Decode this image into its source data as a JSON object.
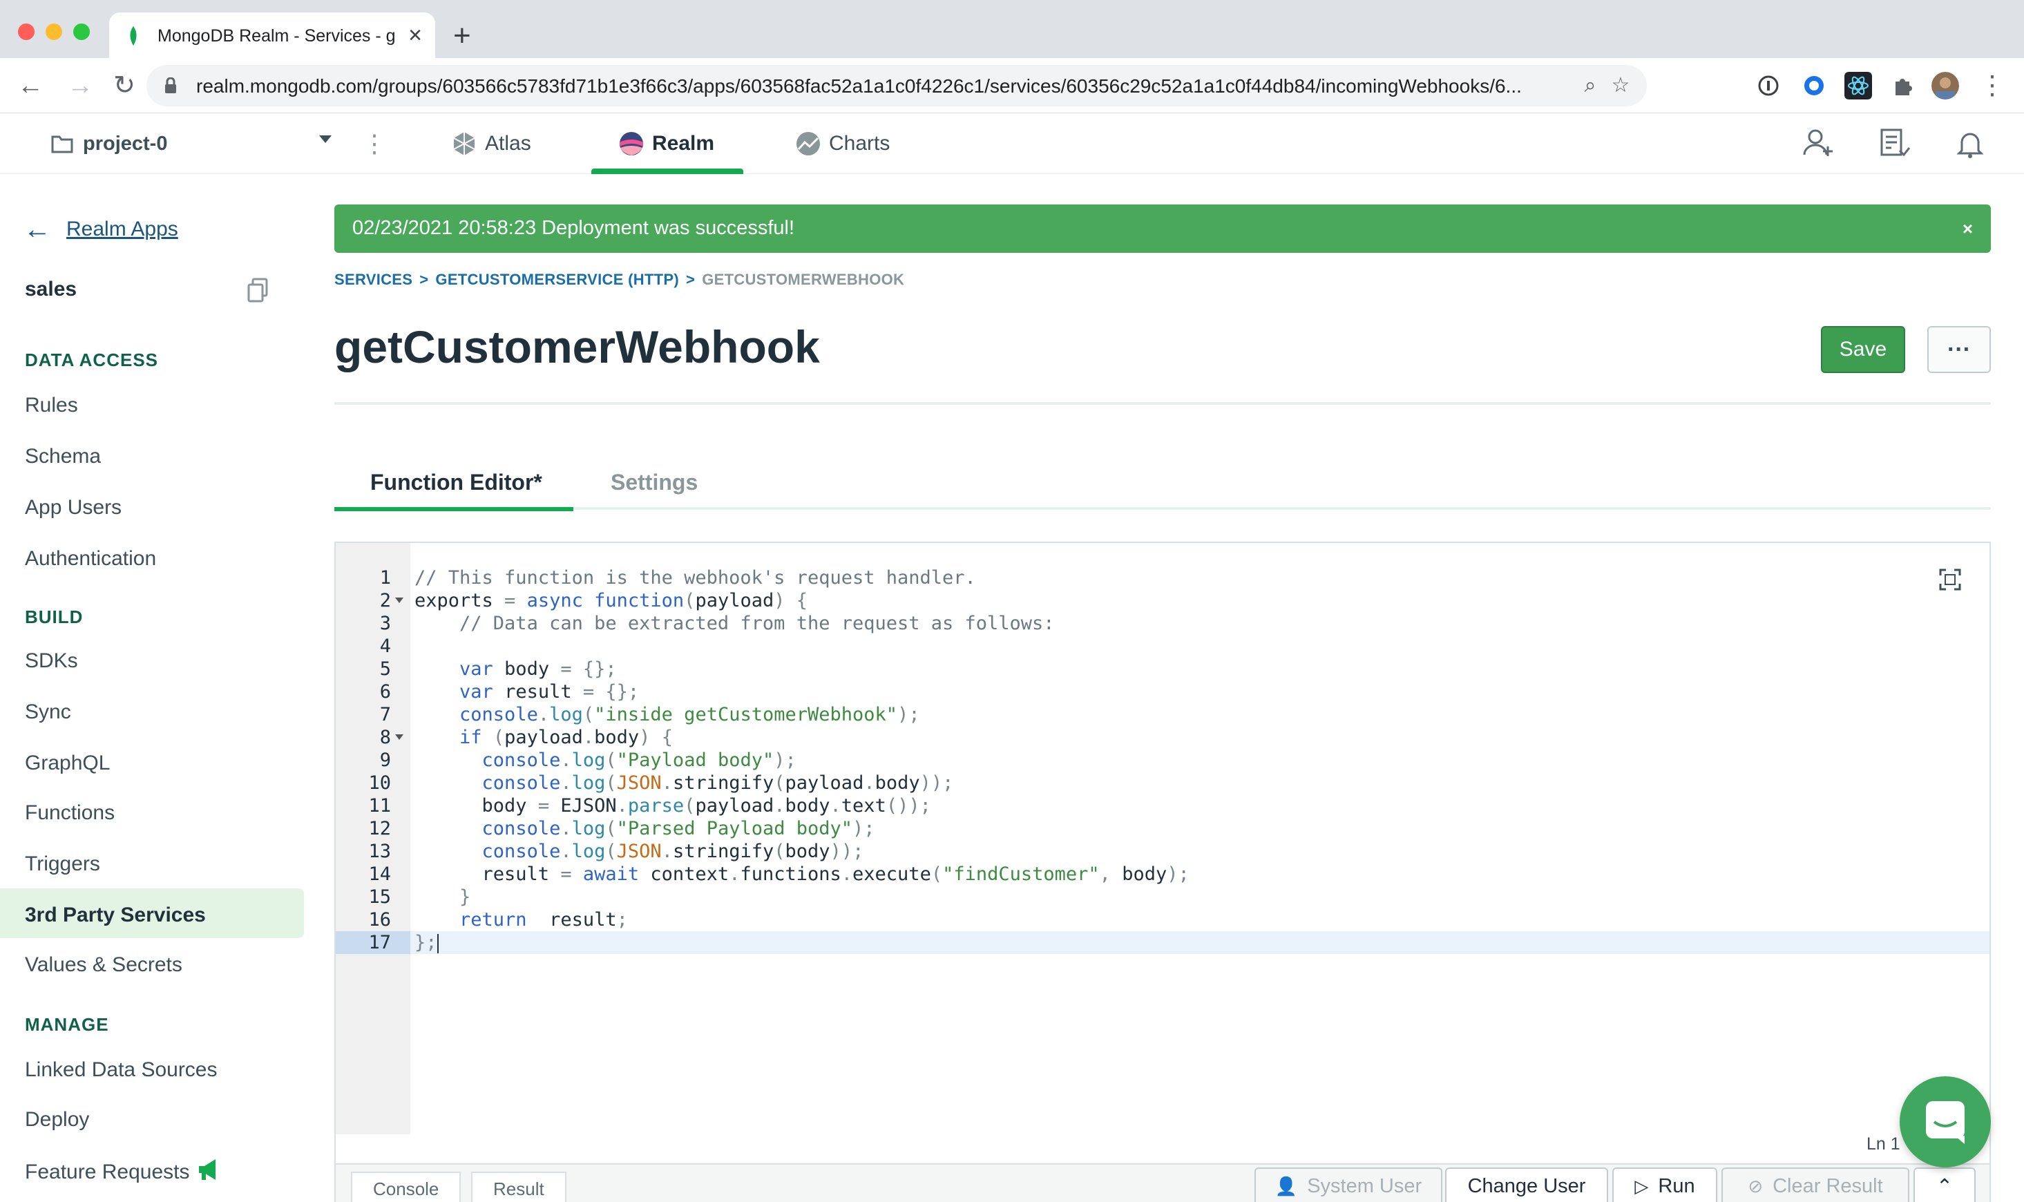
{
  "browser": {
    "tab_title": "MongoDB Realm - Services - g",
    "url": "realm.mongodb.com/groups/603566c5783fd71b1e3f66c3/apps/603568fac52a1a1c0f4226c1/services/60356c29c52a1a1c0f44db84/incomingWebhooks/6..."
  },
  "topnav": {
    "project": "project-0",
    "tabs": [
      "Atlas",
      "Realm",
      "Charts"
    ],
    "active_tab": "Realm",
    "accent_color": "#13aa52"
  },
  "sidebar": {
    "back_label": "Realm Apps",
    "app_name": "sales",
    "sections": [
      {
        "title": "DATA ACCESS",
        "items": [
          "Rules",
          "Schema",
          "App Users",
          "Authentication"
        ]
      },
      {
        "title": "BUILD",
        "items": [
          "SDKs",
          "Sync",
          "GraphQL",
          "Functions",
          "Triggers",
          "3rd Party Services",
          "Values & Secrets"
        ]
      },
      {
        "title": "MANAGE",
        "items": [
          "Linked Data Sources",
          "Deploy",
          "Feature Requests"
        ]
      }
    ],
    "active_item": "3rd Party Services"
  },
  "banner": {
    "text": "02/23/2021 20:58:23 Deployment was successful!",
    "close": "×",
    "color": "#4aa85a"
  },
  "breadcrumb": {
    "items": [
      "SERVICES",
      "GETCUSTOMERSERVICE (HTTP)",
      "GETCUSTOMERWEBHOOK"
    ],
    "separator": ">"
  },
  "page": {
    "title": "getCustomerWebhook",
    "save_label": "Save",
    "more_label": "···"
  },
  "editor_tabs": {
    "items": [
      "Function Editor*",
      "Settings"
    ],
    "active": "Function Editor*"
  },
  "editor": {
    "lines": [
      "// This function is the webhook's request handler.",
      "exports = async function(payload) {",
      "    // Data can be extracted from the request as follows:",
      "",
      "    var body = {};",
      "    var result = {};",
      "    console.log(\"inside getCustomerWebhook\");",
      "    if (payload.body) {",
      "      console.log(\"Payload body\");",
      "      console.log(JSON.stringify(payload.body));",
      "      body = EJSON.parse(payload.body.text());",
      "      console.log(\"Parsed Payload body\");",
      "      console.log(JSON.stringify(body));",
      "      result = await context.functions.execute(\"findCustomer\", body);",
      "    }",
      "    return  result;",
      "};"
    ],
    "current_line": 17,
    "status": "Ln 1"
  },
  "bottom_bar": {
    "tabs": [
      "Console",
      "Result"
    ],
    "buttons": {
      "system_user": "System User",
      "change_user": "Change User",
      "run": "Run",
      "clear_result": "Clear Result"
    }
  }
}
